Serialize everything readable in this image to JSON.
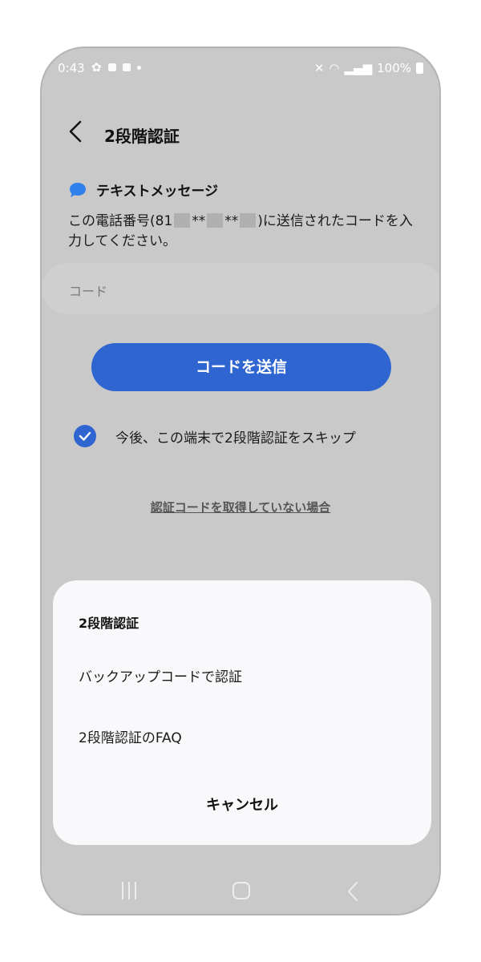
{
  "status_bar": {
    "time": "0:43",
    "battery": "100%"
  },
  "header": {
    "title": "2段階認証"
  },
  "method": {
    "label": "テキストメッセージ",
    "desc_part1": "この電話番号(81",
    "desc_part2": "**",
    "desc_part3": "**",
    "desc_part4": ")に送信されたコードを入力してください。"
  },
  "code_input": {
    "placeholder": "コード"
  },
  "send_button": {
    "label": "コードを送信"
  },
  "skip_option": {
    "label": "今後、この端末で2段階認証をスキップ",
    "checked": true
  },
  "no_code_link": "認証コードを取得していない場合",
  "sheet": {
    "title": "2段階認証",
    "items": [
      {
        "label": "バックアップコードで認証"
      },
      {
        "label": "2段階認証のFAQ"
      }
    ],
    "cancel": "キャンセル"
  },
  "colors": {
    "accent": "#2f65d1",
    "background": "#c9c9c9",
    "sheet": "#f9f9fb"
  }
}
